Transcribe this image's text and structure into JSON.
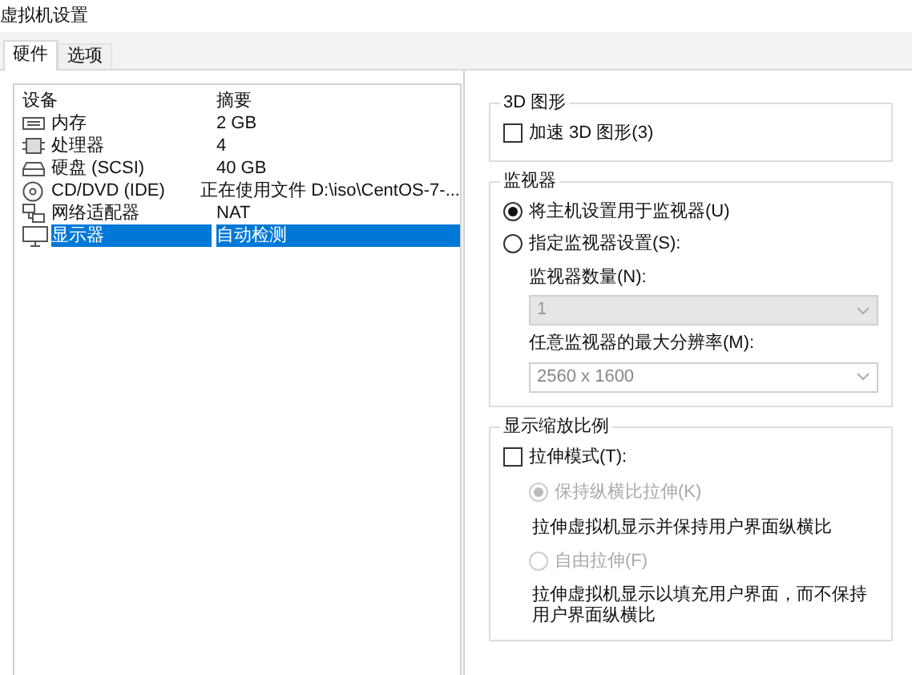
{
  "window": {
    "title": "虚拟机设置"
  },
  "tabs": [
    {
      "label": "硬件",
      "selected": true
    },
    {
      "label": "选项",
      "selected": false
    }
  ],
  "devices": {
    "columns": [
      "设备",
      "摘要"
    ],
    "rows": [
      {
        "kind": "memory",
        "device": "内存",
        "summary": "2 GB",
        "selected": false
      },
      {
        "kind": "cpu",
        "device": "处理器",
        "summary": "4",
        "selected": false
      },
      {
        "kind": "disk",
        "device": "硬盘 (SCSI)",
        "summary": "40 GB",
        "selected": false
      },
      {
        "kind": "cd",
        "device": "CD/DVD (IDE)",
        "summary": "正在使用文件 D:\\iso\\CentOS-7-...",
        "selected": false
      },
      {
        "kind": "network",
        "device": "网络适配器",
        "summary": "NAT",
        "selected": false
      },
      {
        "kind": "display",
        "device": "显示器",
        "summary": "自动检测",
        "selected": true
      }
    ]
  },
  "graphics_3d": {
    "title": "3D 图形",
    "accelerate": {
      "label": "加速 3D 图形(3)",
      "checked": false
    }
  },
  "monitor": {
    "title": "监视器",
    "options": [
      {
        "label": "将主机设置用于监视器(U)",
        "selected": true
      },
      {
        "label": "指定监视器设置(S):",
        "selected": false
      }
    ],
    "count_label": "监视器数量(N):",
    "count_value": "1",
    "resolution_label": "任意监视器的最大分辨率(M):",
    "resolution_value": "2560 x 1600"
  },
  "scaling": {
    "title": "显示缩放比例",
    "stretch": {
      "label": "拉伸模式(T):",
      "checked": false
    },
    "options": [
      {
        "label": "保持纵横比拉伸(K)",
        "selected": true,
        "disabled": true,
        "description": "拉伸虚拟机显示并保持用户界面纵横比"
      },
      {
        "label": "自由拉伸(F)",
        "selected": false,
        "disabled": true,
        "description": "拉伸虚拟机显示以填充用户界面，而不保持用户界面纵横比"
      }
    ]
  }
}
